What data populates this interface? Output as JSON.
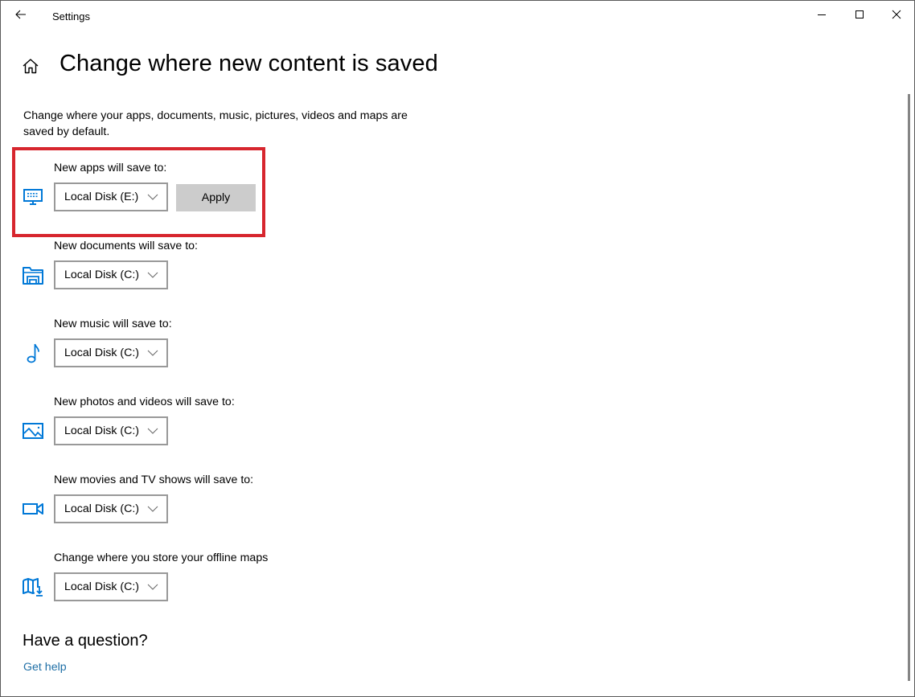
{
  "window": {
    "title": "Settings",
    "controls": {
      "minimize": "minimize-icon",
      "maximize": "maximize-icon",
      "close": "close-icon"
    },
    "back_icon": "arrow-left-icon"
  },
  "page": {
    "home_icon": "home-icon",
    "title": "Change where new content is saved",
    "description": "Change where your apps, documents, music, pictures, videos and maps are saved by default."
  },
  "settings": [
    {
      "id": "apps",
      "label": "New apps will save to:",
      "icon": "monitor-icon",
      "value": "Local Disk (E:)",
      "apply_label": "Apply",
      "highlighted": true
    },
    {
      "id": "documents",
      "label": "New documents will save to:",
      "icon": "folder-icon",
      "value": "Local Disk (C:)"
    },
    {
      "id": "music",
      "label": "New music will save to:",
      "icon": "music-note-icon",
      "value": "Local Disk (C:)"
    },
    {
      "id": "photos",
      "label": "New photos and videos will save to:",
      "icon": "picture-icon",
      "value": "Local Disk (C:)"
    },
    {
      "id": "movies",
      "label": "New movies and TV shows will save to:",
      "icon": "video-camera-icon",
      "value": "Local Disk (C:)"
    },
    {
      "id": "maps",
      "label": "Change where you store your offline maps",
      "icon": "map-download-icon",
      "value": "Local Disk (C:)"
    }
  ],
  "help": {
    "heading": "Have a question?",
    "link": "Get help"
  },
  "colors": {
    "accent": "#0078d7",
    "link": "#1f6fa6",
    "highlight": "#d7262e",
    "apply_bg": "#cccccc",
    "dropdown_border": "#999999"
  }
}
